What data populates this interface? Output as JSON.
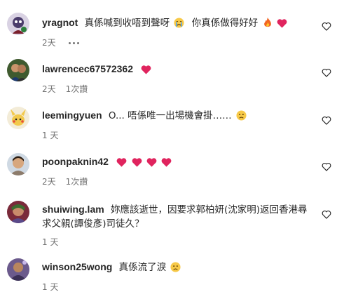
{
  "comments": [
    {
      "username": "yragnot",
      "text": "真係喊到收唔到聲呀",
      "text2": "你真係做得好好",
      "time": "2天",
      "likes": ""
    },
    {
      "username": "lawrencec67572362",
      "text": "",
      "time": "2天",
      "likes": "1次讚"
    },
    {
      "username": "leemingyuen",
      "text": "O... 唔係唯一出場機會掛……",
      "time": "1 天",
      "likes": ""
    },
    {
      "username": "poonpaknin42",
      "text": "",
      "time": "2天",
      "likes": "1次讚"
    },
    {
      "username": "shuiwing.lam",
      "text": "妳應該逝世，因要求郭柏妍(沈家明)返回香港尋求父親(譚俊彥)司徒久？",
      "time": "1 天",
      "likes": ""
    },
    {
      "username": "winson25wong",
      "text": "真係流了淚",
      "time": "1 天",
      "likes": ""
    }
  ],
  "colors": {
    "heart_red": "#e0245e",
    "meta_gray": "#737373",
    "text": "#262626"
  },
  "icons": {
    "like": "heart-outline-icon",
    "more": "more-dots-icon",
    "emojis": [
      "crying-face-emoji",
      "fire-emoji",
      "red-heart-emoji",
      "sad-face-emoji"
    ]
  }
}
